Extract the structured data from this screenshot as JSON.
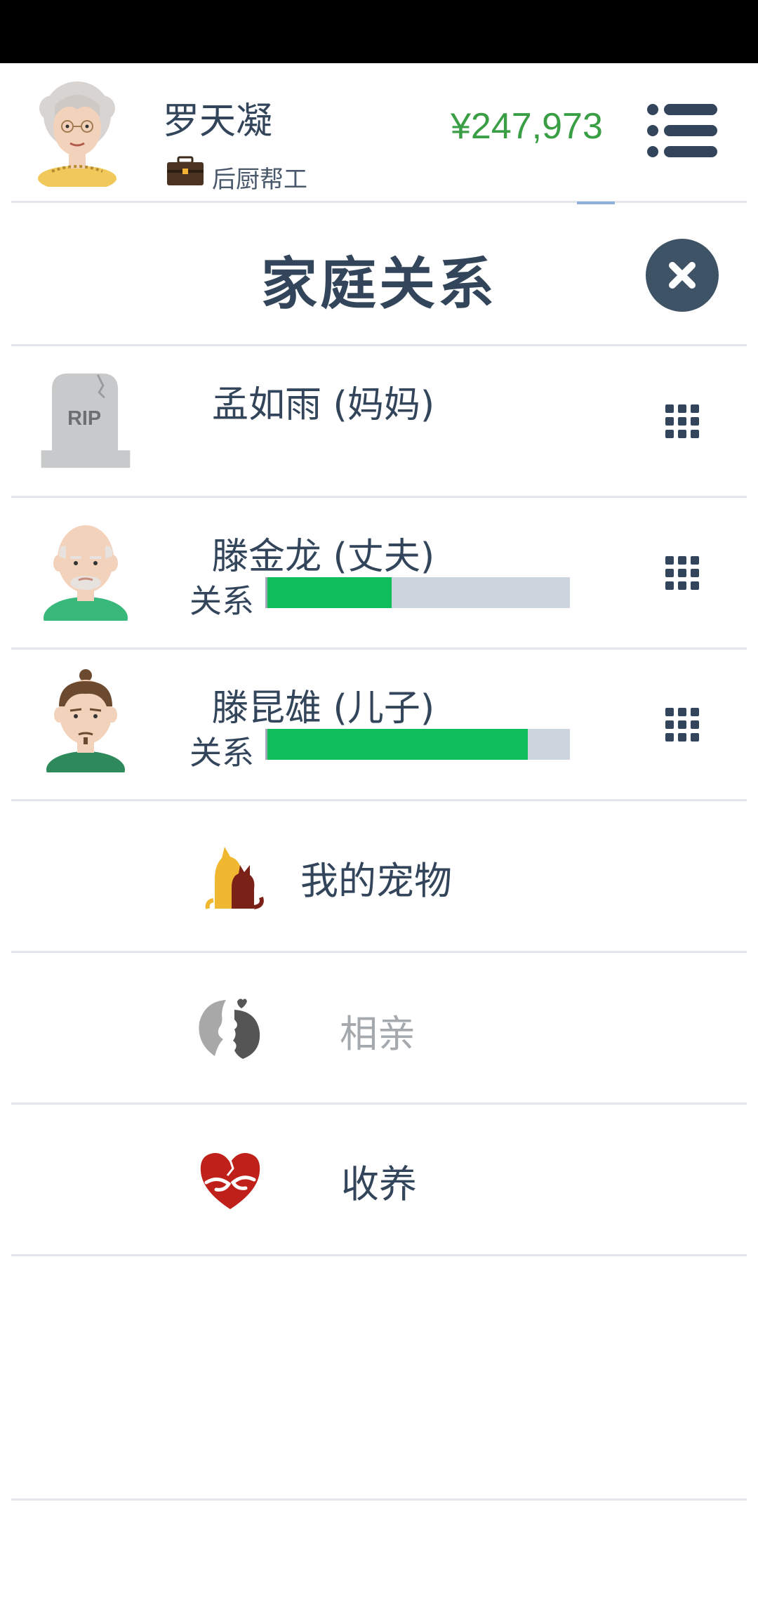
{
  "header": {
    "player_name": "罗天凝",
    "job": "后厨帮工",
    "money": "¥247,973"
  },
  "panel": {
    "title": "家庭关系"
  },
  "family": [
    {
      "name": "孟如雨 (妈妈)",
      "deceased": true
    },
    {
      "name": "滕金龙 (丈夫)",
      "relation_label": "关系",
      "relation_level": 0.41
    },
    {
      "name": "滕昆雄 (儿子)",
      "relation_label": "关系",
      "relation_level": 0.86
    }
  ],
  "actions": {
    "pets": "我的宠物",
    "matchmaking": "相亲",
    "adoption": "收养"
  },
  "colors": {
    "money": "#3a9e44",
    "relation_fill": "#0fbe5a",
    "relation_track": "#ccd5dd",
    "text_primary": "#33455a",
    "text_disabled": "#a4a9ae"
  },
  "icons": {
    "menu": "list-icon",
    "close": "close-icon",
    "row_options": "grid-icon",
    "job": "briefcase-icon"
  }
}
